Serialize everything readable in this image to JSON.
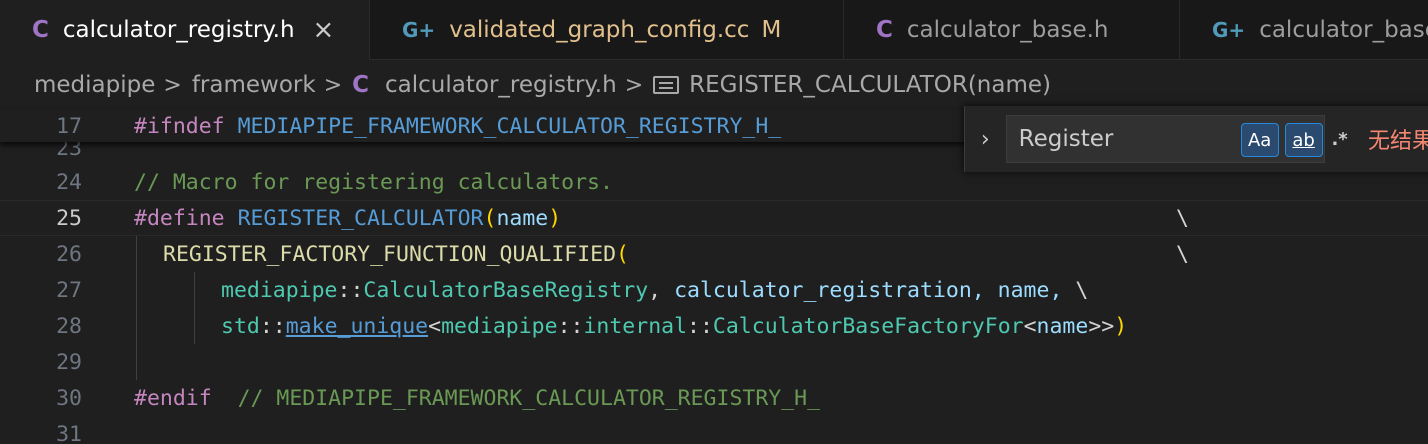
{
  "tabs": [
    {
      "icon": "C",
      "label": "calculator_registry.h",
      "close": "×"
    },
    {
      "icon": "G+",
      "label": "validated_graph_config.cc",
      "badge": "M"
    },
    {
      "icon": "C",
      "label": "calculator_base.h"
    },
    {
      "icon": "G+",
      "label": "calculator_base"
    }
  ],
  "breadcrumb": {
    "items": [
      "mediapipe",
      "framework",
      "calculator_registry.h",
      "REGISTER_CALCULATOR(name)"
    ],
    "file_icon": "C",
    "separator": ">"
  },
  "find": {
    "query": "Register",
    "toggle_icon": "›",
    "match_case": "Aa",
    "whole_word": "ab",
    "regex": ".*",
    "result": "无结果"
  },
  "editor": {
    "sticky": {
      "ln": "17",
      "directive": "#ifndef",
      "macro": "MEDIAPIPE_FRAMEWORK_CALCULATOR_REGISTRY_H_"
    },
    "line_numbers": [
      "23",
      "24",
      "25",
      "26",
      "27",
      "28",
      "29",
      "30",
      "31"
    ],
    "code": {
      "comment24": "// Macro for registering calculators.",
      "define": "#define",
      "macro_name": "REGISTER_CALCULATOR",
      "lparen": "(",
      "param": "name",
      "rparen": ")",
      "bs": "\\",
      "fn26": "REGISTER_FACTORY_FUNCTION_QUALIFIED",
      "ns_mediapipe": "mediapipe",
      "scope": "::",
      "registry_type": "CalculatorBaseRegistry",
      "comma_sp": ", ",
      "reg_ident": "calculator_registration",
      "name_comma": ", name, ",
      "std": "std",
      "make_unique": "make_unique",
      "lt": "<",
      "internal": "internal",
      "factory": "CalculatorBaseFactoryFor",
      "gtgt": ">>",
      "endif": "#endif",
      "endif_comment": "// MEDIAPIPE_FRAMEWORK_CALCULATOR_REGISTRY_H_"
    }
  }
}
